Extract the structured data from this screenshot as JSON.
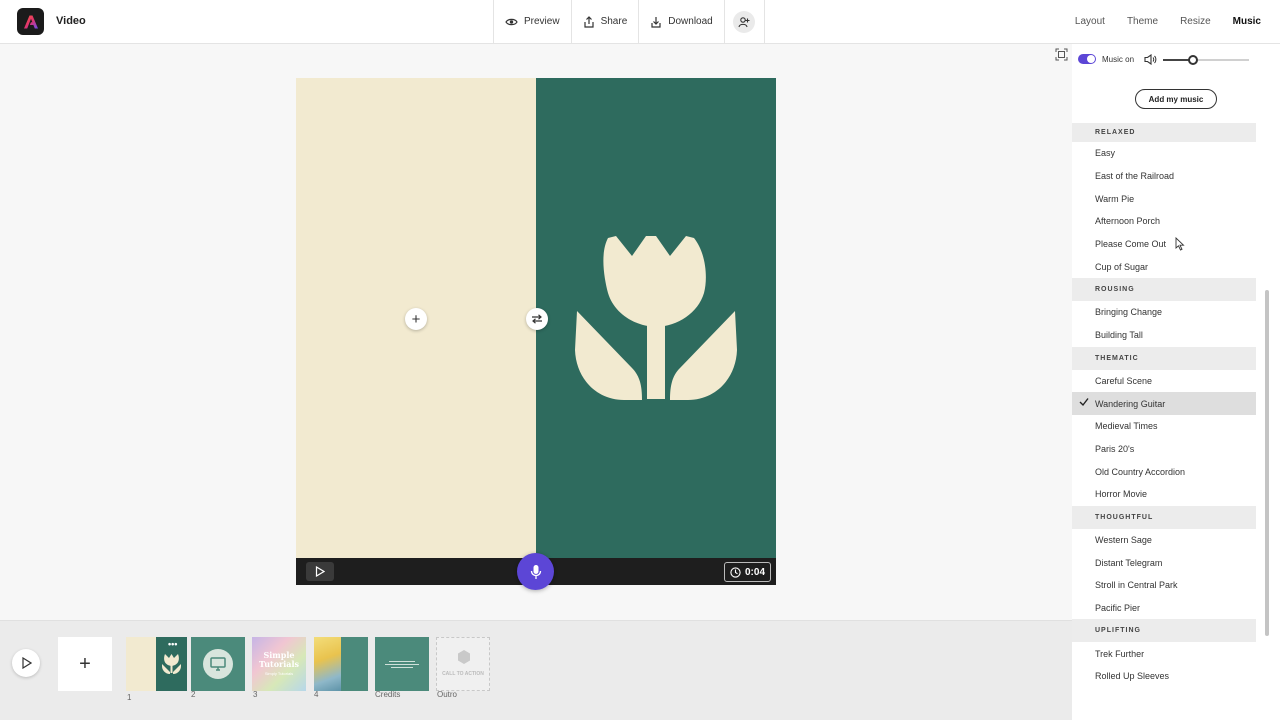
{
  "app": {
    "title": "Video"
  },
  "toolbar": {
    "preview_label": "Preview",
    "share_label": "Share",
    "download_label": "Download"
  },
  "right_tabs": [
    {
      "label": "Layout",
      "active": false
    },
    {
      "label": "Theme",
      "active": false
    },
    {
      "label": "Resize",
      "active": false
    },
    {
      "label": "Music",
      "active": true
    }
  ],
  "player": {
    "duration": "0:04"
  },
  "timeline": {
    "slides": [
      {
        "label": "1"
      },
      {
        "label": "2"
      },
      {
        "label": "3",
        "text_title": "Simple Tutorials",
        "text_sub": "Simply Tutorials"
      },
      {
        "label": "4"
      },
      {
        "label": "Credits"
      },
      {
        "label": "Outro",
        "placeholder": "CALL TO ACTION"
      }
    ]
  },
  "music_panel": {
    "toggle_label": "Music on",
    "music_on": true,
    "volume": 0.35,
    "add_music_label": "Add my music",
    "selected_track": "Wandering Guitar",
    "categories": [
      {
        "name": "RELAXED",
        "tracks": [
          "Easy",
          "East of the Railroad",
          "Warm Pie",
          "Afternoon Porch",
          "Please Come Out",
          "Cup of Sugar"
        ]
      },
      {
        "name": "ROUSING",
        "tracks": [
          "Bringing Change",
          "Building Tall"
        ]
      },
      {
        "name": "THEMATIC",
        "tracks": [
          "Careful Scene",
          "Wandering Guitar",
          "Medieval Times",
          "Paris 20's",
          "Old Country Accordion",
          "Horror Movie"
        ]
      },
      {
        "name": "THOUGHTFUL",
        "tracks": [
          "Western Sage",
          "Distant Telegram",
          "Stroll in Central Park",
          "Pacific Pier"
        ]
      },
      {
        "name": "UPLIFTING",
        "tracks": [
          "Trek Further",
          "Rolled Up Sleeves"
        ]
      }
    ]
  },
  "colors": {
    "accent": "#5c46d6",
    "cream": "#f2ead0",
    "teal": "#2e6b5e"
  }
}
